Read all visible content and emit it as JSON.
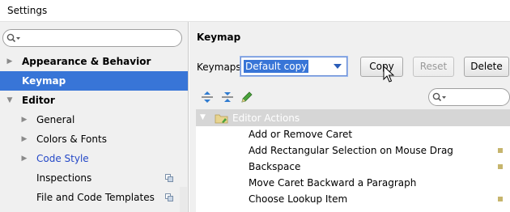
{
  "window": {
    "title": "Settings"
  },
  "sidebar": {
    "search": {
      "value": "",
      "placeholder": ""
    },
    "items": [
      {
        "label": "Appearance & Behavior",
        "level": 0,
        "expander": "collapsed",
        "bold": true,
        "selected": false,
        "link": false,
        "project_icon": false
      },
      {
        "label": "Keymap",
        "level": 0,
        "expander": "none",
        "bold": true,
        "selected": true,
        "link": false,
        "project_icon": false
      },
      {
        "label": "Editor",
        "level": 0,
        "expander": "expanded",
        "bold": true,
        "selected": false,
        "link": false,
        "project_icon": false
      },
      {
        "label": "General",
        "level": 1,
        "expander": "collapsed",
        "bold": false,
        "selected": false,
        "link": false,
        "project_icon": false
      },
      {
        "label": "Colors & Fonts",
        "level": 1,
        "expander": "collapsed",
        "bold": false,
        "selected": false,
        "link": false,
        "project_icon": false
      },
      {
        "label": "Code Style",
        "level": 1,
        "expander": "collapsed",
        "bold": false,
        "selected": false,
        "link": true,
        "project_icon": false
      },
      {
        "label": "Inspections",
        "level": 1,
        "expander": "none",
        "bold": false,
        "selected": false,
        "link": false,
        "project_icon": true
      },
      {
        "label": "File and Code Templates",
        "level": 1,
        "expander": "none",
        "bold": false,
        "selected": false,
        "link": false,
        "project_icon": true
      }
    ]
  },
  "keymap_panel": {
    "heading": "Keymap",
    "keymaps_label": "Keymaps:",
    "selected_keymap": "Default copy",
    "buttons": {
      "copy": "Copy",
      "reset": "Reset",
      "delete": "Delete"
    },
    "toolbar_icons": [
      "expand-all-icon",
      "collapse-all-icon",
      "edit-shortcut-icon"
    ],
    "filter": {
      "value": ""
    },
    "group": {
      "label": "Editor Actions",
      "expanded": true
    },
    "actions": [
      {
        "label": "Add or Remove Caret",
        "has_shortcut": false
      },
      {
        "label": "Add Rectangular Selection on Mouse Drag",
        "has_shortcut": true
      },
      {
        "label": "Backspace",
        "has_shortcut": true
      },
      {
        "label": "Move Caret Backward a Paragraph",
        "has_shortcut": false
      },
      {
        "label": "Choose Lookup Item",
        "has_shortcut": true
      }
    ]
  },
  "colors": {
    "selection": "#3875d7",
    "panel_background": "#f0f0f0",
    "link_text": "#2448c7",
    "group_row": "#d6d6d6"
  }
}
